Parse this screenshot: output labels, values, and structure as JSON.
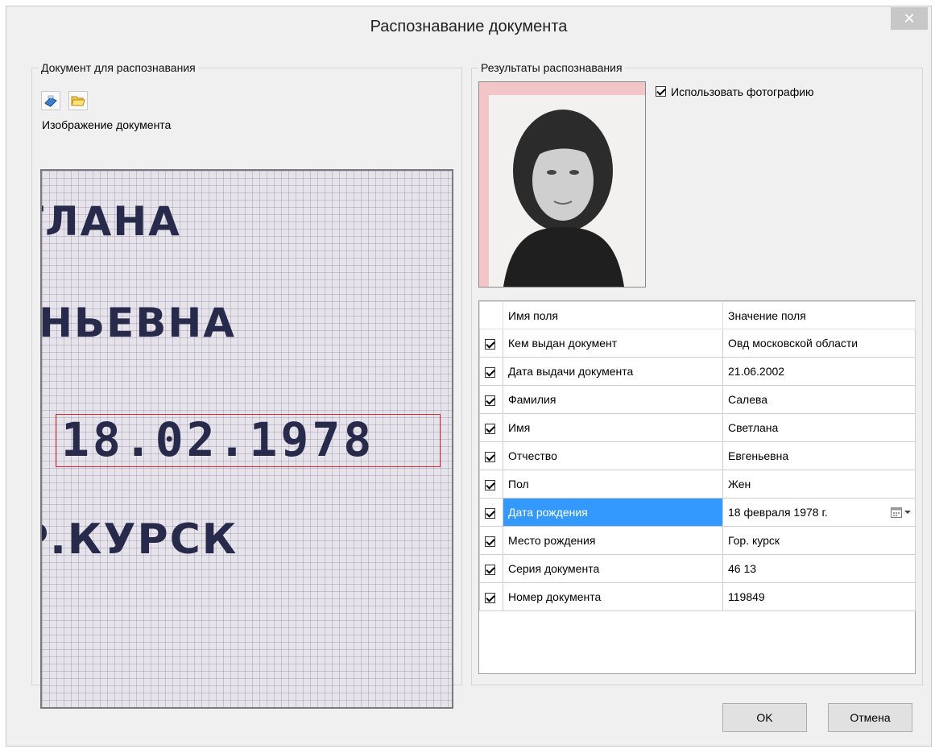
{
  "window": {
    "title": "Распознавание документа",
    "close_glyph": "✕"
  },
  "left_group": {
    "legend": "Документ для распознавания",
    "scan_icon": "scanner-icon",
    "open_icon": "folder-open-icon",
    "image_label": "Изображение документа",
    "image_lines": [
      "ТЛАНА",
      "ЕНЬЕВНА",
      "18.02.1978",
      "Р.КУРСК"
    ]
  },
  "right_group": {
    "legend": "Результаты распознавания",
    "use_photo": {
      "label": "Использовать фотографию",
      "checked": true
    },
    "columns": [
      "Имя поля",
      "Значение поля"
    ],
    "rows": [
      {
        "name": "Кем выдан документ",
        "value": "Овд московской области",
        "checked": true
      },
      {
        "name": "Дата выдачи документа",
        "value": "21.06.2002",
        "checked": true
      },
      {
        "name": "Фамилия",
        "value": "Салева",
        "checked": true
      },
      {
        "name": "Имя",
        "value": "Светлана",
        "checked": true
      },
      {
        "name": "Отчество",
        "value": "Евгеньевна",
        "checked": true
      },
      {
        "name": "Пол",
        "value": "Жен",
        "checked": true
      },
      {
        "name": "Дата рождения",
        "value": "18 февраля  1978 г.",
        "checked": true,
        "selected": true
      },
      {
        "name": "Место рождения",
        "value": "Гор. курск",
        "checked": true
      },
      {
        "name": "Серия документа",
        "value": "46 13",
        "checked": true
      },
      {
        "name": "Номер документа",
        "value": "119849",
        "checked": true
      }
    ]
  },
  "buttons": {
    "ok": "OK",
    "cancel": "Отмена"
  },
  "colors": {
    "selection": "#3399ff",
    "highlight_box": "#d92b2b",
    "close_button": "#c7c7c7"
  }
}
